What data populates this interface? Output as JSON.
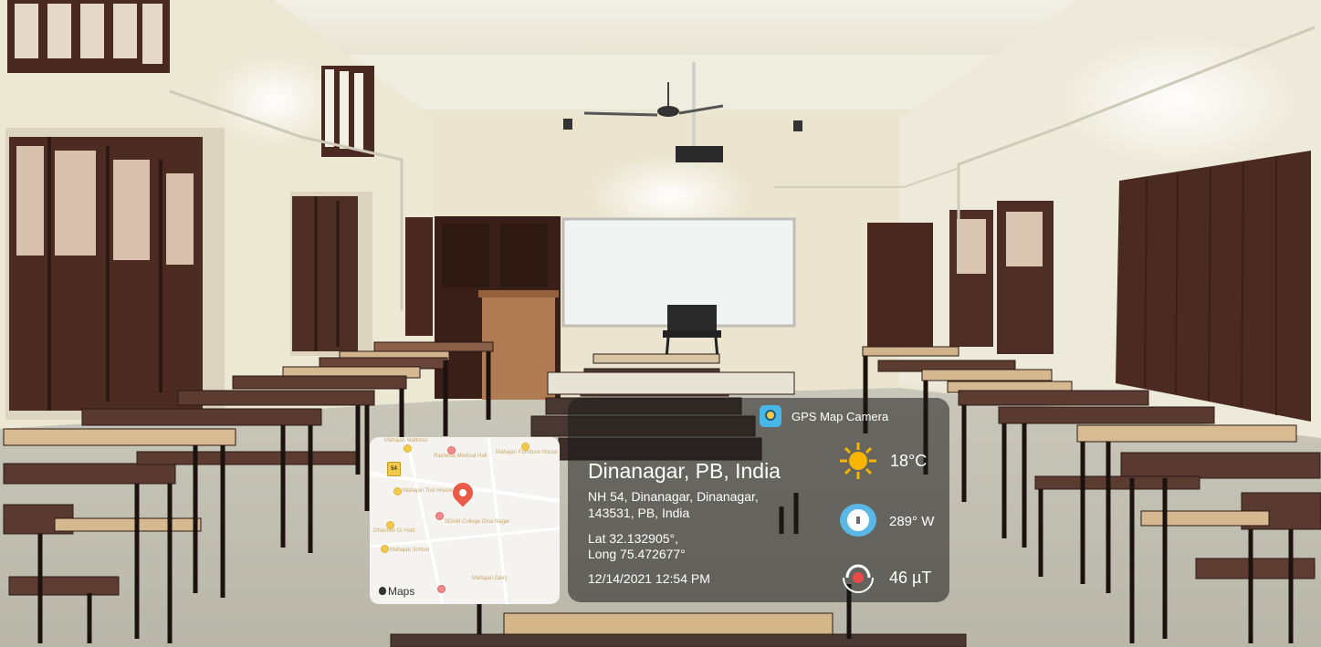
{
  "stamp": {
    "app_name": "GPS Map Camera",
    "location_title": "Dinanagar, PB, India",
    "address_line1": "NH 54, Dinanagar, Dinanagar,",
    "address_line2": "143531, PB, India",
    "lat": "Lat 32.132905°,",
    "long": "Long 75.472677°",
    "datetime": "12/14/2021 12:54 PM",
    "temperature": "18°C",
    "compass": "289° W",
    "magnetic": "46 µT",
    "map_attribution": "Maps",
    "highway_shield": "54",
    "icons": {
      "app": "map-camera-icon",
      "weather": "sun-icon",
      "compass": "compass-icon",
      "magnetic": "magnet-icon",
      "pin": "location-pin-icon",
      "apple": "apple-icon"
    },
    "colors": {
      "panel": "#191919",
      "text": "#ffffff",
      "sun": "#f7b500",
      "pin": "#ea5a47",
      "map_bg": "#f4f3ef"
    }
  },
  "map_labels": [
    "Mahajan Mattress",
    "Rasheda Medical Hall",
    "Mahajan Furniture House",
    "Mahajan Tool House",
    "SDAM College Dina Nagar",
    "Dharmvir Di Hatti",
    "Mahajan School",
    "Mahajan Dairy"
  ]
}
